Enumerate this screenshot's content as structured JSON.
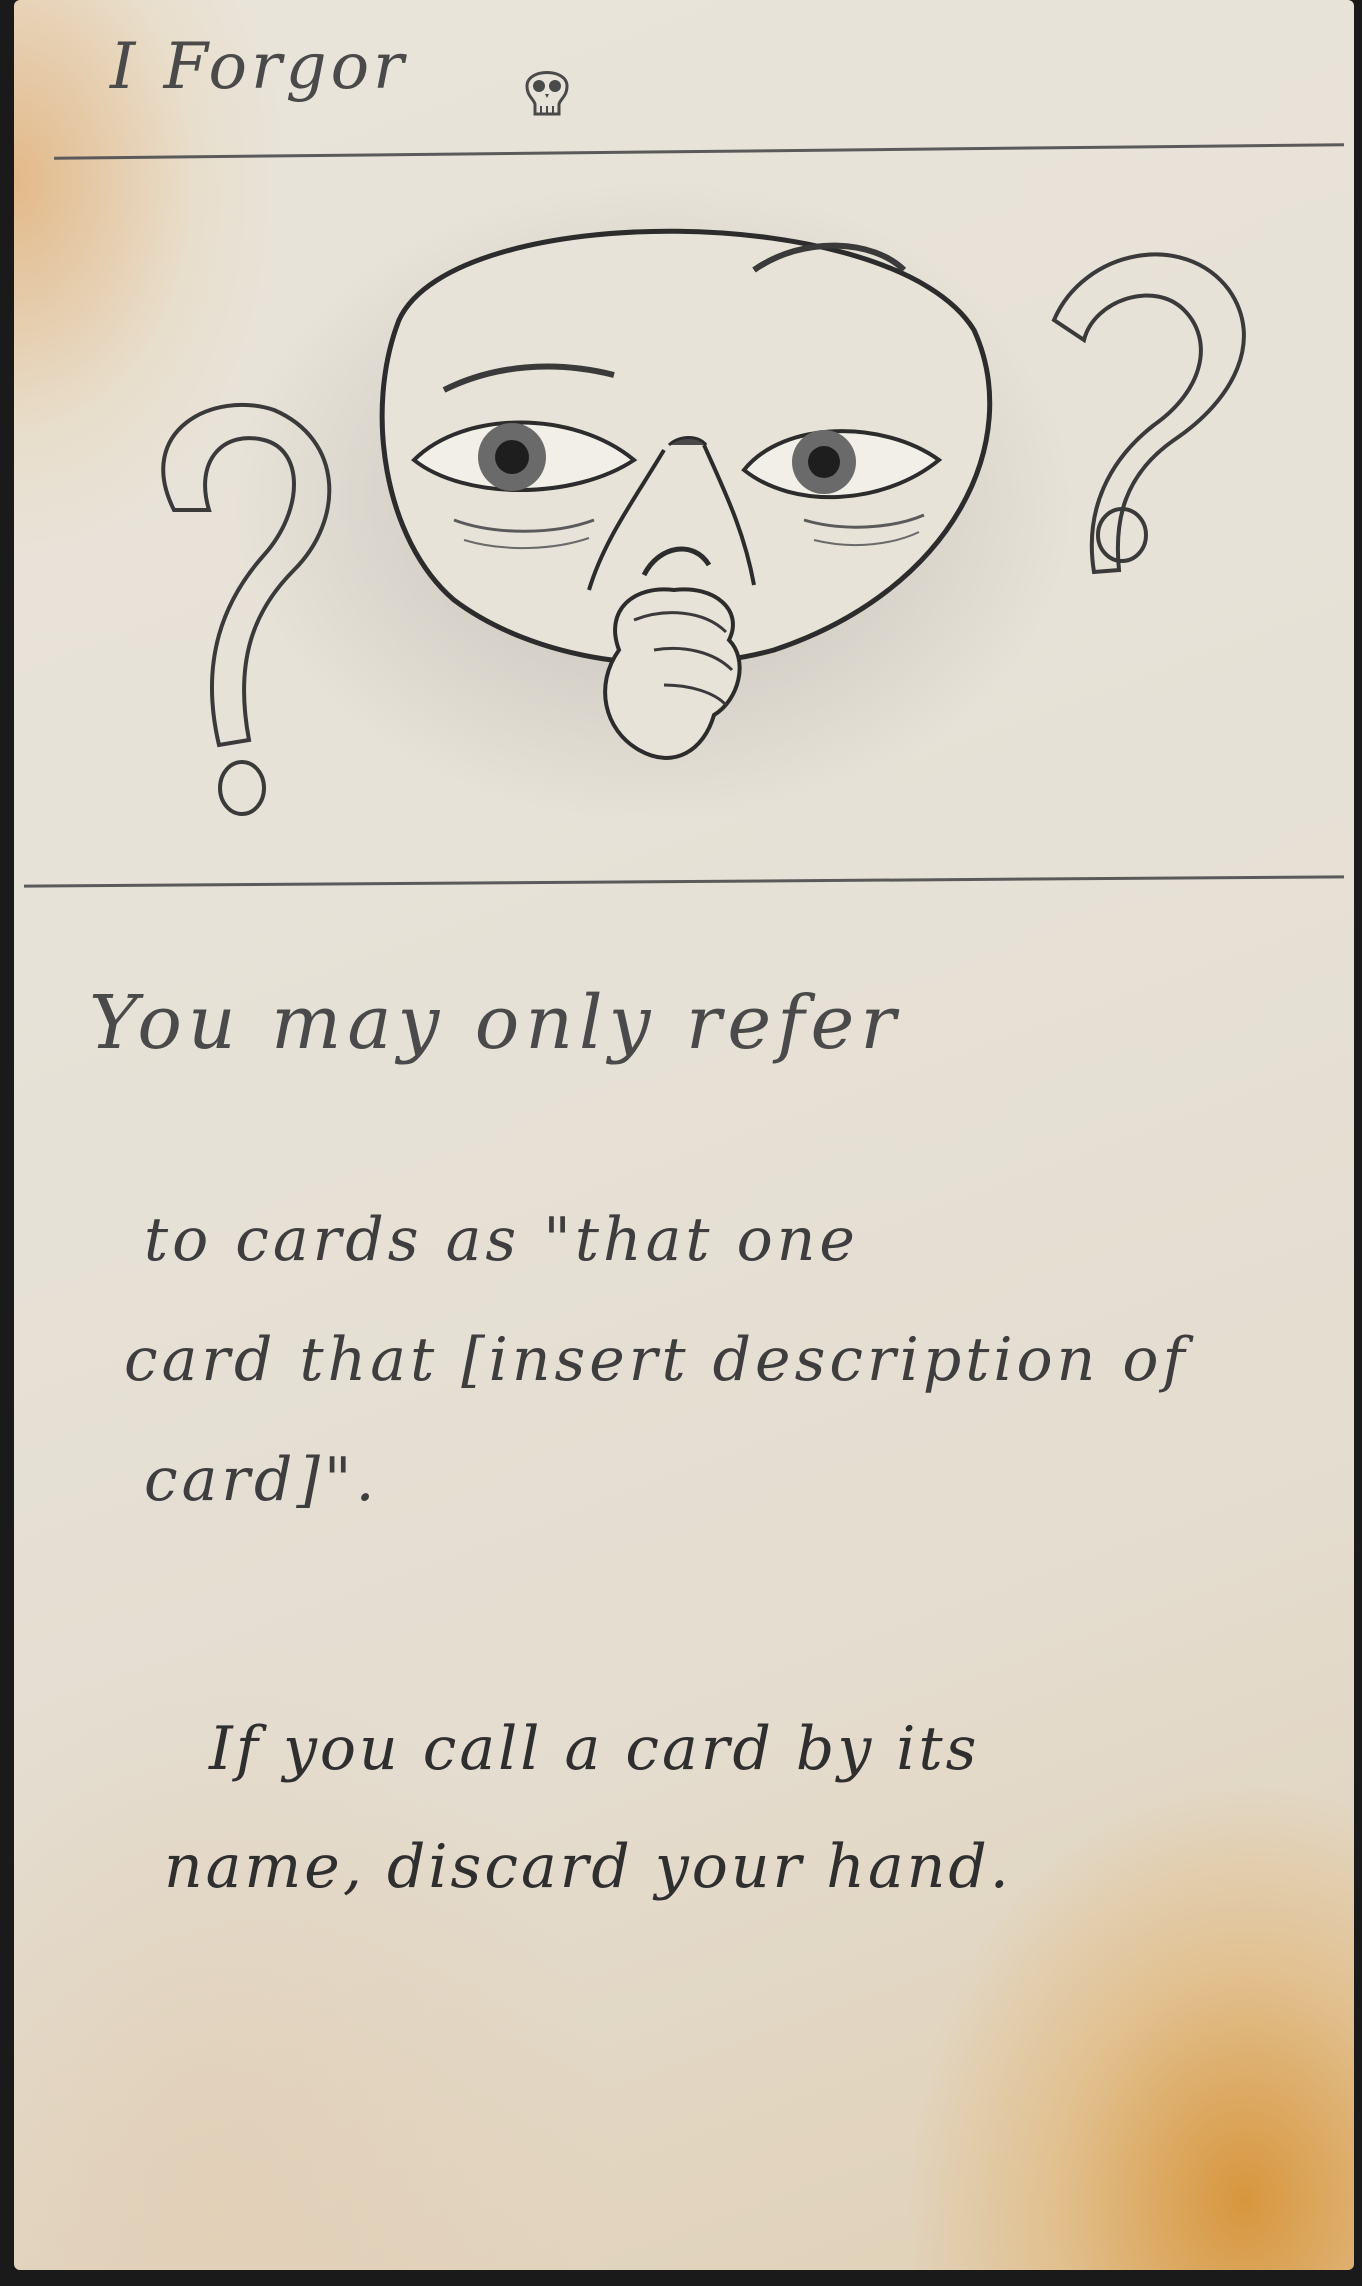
{
  "card": {
    "title": "I Forgor",
    "title_icon": "skull-icon",
    "illustration": {
      "subject": "confused face with hand on chin",
      "icons": [
        "question-mark-icon",
        "question-mark-icon"
      ]
    },
    "rule_text": {
      "line1": "You may only refer",
      "line2": "to cards as \"that one",
      "line3": "card that [insert description of",
      "line4": "card]\"."
    },
    "penalty_text": {
      "line1": "If you call a card by its",
      "line2": "name, discard your hand."
    }
  },
  "colors": {
    "paper": "#e7e2d8",
    "pencil": "#3e3e3e",
    "stain": "#d68c28"
  }
}
